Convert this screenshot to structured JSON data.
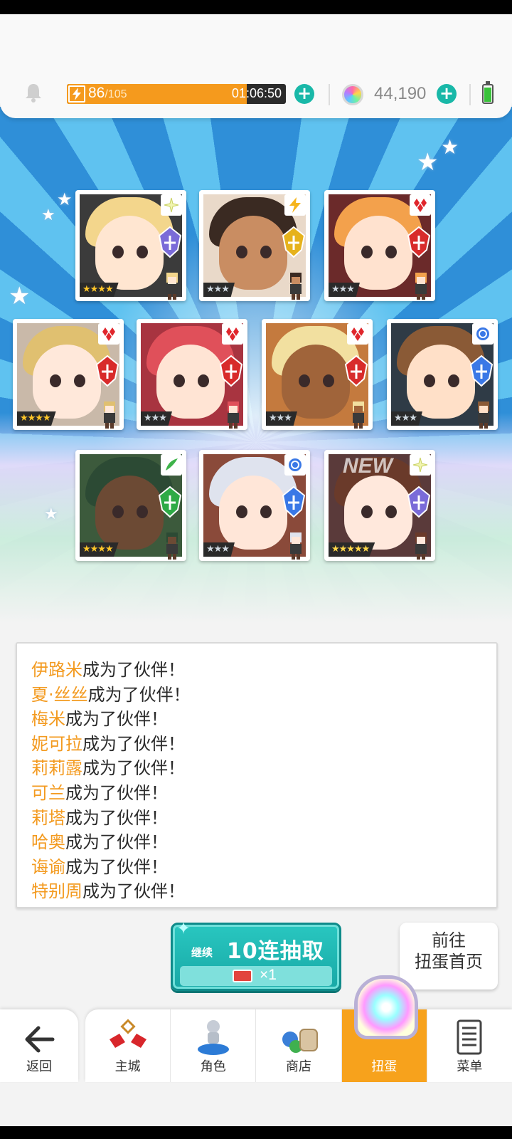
{
  "header": {
    "stamina_current": "86",
    "stamina_max": "/105",
    "stamina_fraction": 0.82,
    "timer": "01:06:50",
    "gems": "44,190"
  },
  "cards": [
    {
      "stars": "★★★★",
      "element": "light",
      "tier": "gold",
      "new": ""
    },
    {
      "stars": "★★★",
      "element": "thunder",
      "tier": "silver",
      "new": ""
    },
    {
      "stars": "★★★",
      "element": "fire",
      "tier": "silver",
      "new": ""
    },
    {
      "stars": "★★★★",
      "element": "fire",
      "tier": "gold",
      "new": ""
    },
    {
      "stars": "★★★",
      "element": "fire",
      "tier": "silver",
      "new": ""
    },
    {
      "stars": "★★★",
      "element": "fire",
      "tier": "silver",
      "new": ""
    },
    {
      "stars": "★★★",
      "element": "water",
      "tier": "silver",
      "new": ""
    },
    {
      "stars": "★★★★",
      "element": "wind",
      "tier": "gold",
      "new": ""
    },
    {
      "stars": "★★★",
      "element": "water",
      "tier": "silver",
      "new": ""
    },
    {
      "stars": "★★★★★",
      "element": "light",
      "tier": "rainbow",
      "new": "NEW"
    }
  ],
  "log": {
    "suffix": "成为了伙伴！",
    "names": [
      "伊路米",
      "夏·丝丝",
      "梅米",
      "妮可拉",
      "莉莉露",
      "可兰",
      "莉塔",
      "哈奥",
      "诲谕",
      "特别周"
    ]
  },
  "pull_button": {
    "prefix": "继续",
    "label": "10连抽取",
    "cost": "×1"
  },
  "home_button": {
    "line1": "前往",
    "line2": "扭蛋首页"
  },
  "nav": {
    "back": "返回",
    "tabs": [
      "主城",
      "角色",
      "商店",
      "扭蛋",
      "菜单"
    ],
    "active_index": 3
  },
  "colors": {
    "accent_orange": "#f7a21c",
    "teal": "#19b8a8",
    "name_orange": "#f39a1f"
  }
}
